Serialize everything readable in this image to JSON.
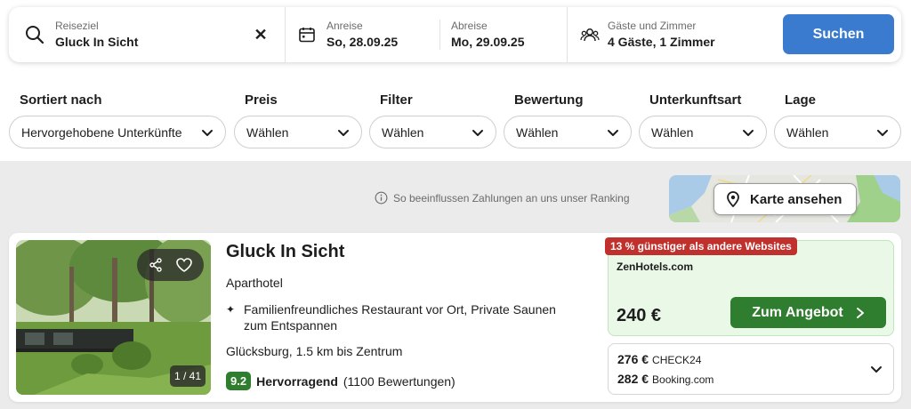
{
  "search": {
    "destination_label": "Reiseziel",
    "destination_value": "Gluck In Sicht",
    "clear_icon": "close-icon",
    "checkin_label": "Anreise",
    "checkin_value": "So, 28.09.25",
    "checkout_label": "Abreise",
    "checkout_value": "Mo, 29.09.25",
    "guests_label": "Gäste und Zimmer",
    "guests_value": "4 Gäste, 1 Zimmer",
    "search_button": "Suchen"
  },
  "filters": [
    {
      "title": "Sortiert nach",
      "value": "Hervorgehobene Unterkünfte"
    },
    {
      "title": "Preis",
      "value": "Wählen"
    },
    {
      "title": "Filter",
      "value": "Wählen"
    },
    {
      "title": "Bewertung",
      "value": "Wählen"
    },
    {
      "title": "Unterkunftsart",
      "value": "Wählen"
    },
    {
      "title": "Lage",
      "value": "Wählen"
    }
  ],
  "ranking_note": "So beeinflussen Zahlungen an uns unser Ranking",
  "map_button": "Karte ansehen",
  "hotel": {
    "name": "Gluck In Sicht",
    "type": "Aparthotel",
    "highlight": "Familienfreundliches Restaurant vor Ort, Private Saunen zum Entspannen",
    "location": "Glücksburg, 1.5 km bis Zentrum",
    "rating_score": "9.2",
    "rating_word": "Hervorragend",
    "rating_count": "(1100 Bewertungen)",
    "photo_counter": "1 / 41"
  },
  "deal": {
    "savings_tag": "13 % günstiger als andere Websites",
    "provider": "ZenHotels.com",
    "price": "240 €",
    "button": "Zum Angebot"
  },
  "other_offers": [
    {
      "price": "276 €",
      "provider": "CHECK24"
    },
    {
      "price": "282 €",
      "provider": "Booking.com"
    }
  ],
  "colors": {
    "primary_blue": "#3a7bd0",
    "deal_green": "#2f7d2f",
    "savings_red": "#c0312d",
    "deal_bg": "#eaf8e8"
  }
}
